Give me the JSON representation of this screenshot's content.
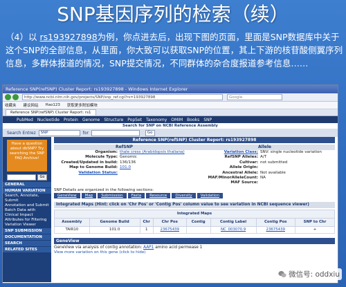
{
  "slide": {
    "title": "SNP基因序列的检索（续）",
    "paragraph_prefix": "（4）以 ",
    "paragraph_link": "rs193927898",
    "paragraph_rest": "为例，你点进去后，出现下图的页面，里面是SNP数据库中关于这个SNP的全部信息，从里面，你大致可以获取SNP的位置，其上下游的核苷酸侧翼序列信息，多群体报道的情况，SNP提交情况，不同群体的杂合度报道参考信息……"
  },
  "browser": {
    "window_title": "Reference SNP(refSNP) Cluster Report: rs193927898 - Windows Internet Explorer",
    "address": "http://www.ncbi.nlm.nih.gov/projects/SNP/snp_ref.cgi?rs=193927898",
    "search_placeholder": "Google",
    "favorites": [
      "收藏夹",
      "建议网站",
      "Hao123",
      "获取更多附加模块"
    ],
    "tab_label": "Reference SNP(refSNP) Cluster Report: rs1"
  },
  "ncbi": {
    "nav": [
      "PubMed",
      "Nucleotide",
      "Protein",
      "Genome",
      "Structure",
      "PopSet",
      "Taxonomy",
      "OMIM",
      "Books",
      "SNP"
    ],
    "search_ref": "Search for SNP on NCBI Reference Assembly",
    "search_label": "Search Entrez",
    "search_db": "SNP",
    "for_label": "for",
    "go_label": "Go",
    "promo": "Have a question about dbSNP? Try searching the SNP FAQ Archive!",
    "leftnav": {
      "sections": [
        "GENERAL",
        "HUMAN VARIATION"
      ],
      "items": [
        "Search, Annotate, Submit",
        "Annotation and Submit Batch Data with Clinical Impact",
        "Attributes for Filtering",
        "Variation Viewer"
      ],
      "more_sections": [
        "SNP SUBMISSION",
        "DOCUMENTATION",
        "SEARCH",
        "RELATED SITES"
      ]
    }
  },
  "report": {
    "header": "Reference SNP(refSNP) Cluster Report: rs193927898",
    "refsnp_label": "RefSNP",
    "allele_label": "Allele",
    "left": [
      {
        "k": "Organism:",
        "v": "thale cress (Arabidopsis thaliana)"
      },
      {
        "k": "Molecule Type:",
        "v": "Genomic"
      },
      {
        "k": "Created/Updated in build:",
        "v": "136/136"
      },
      {
        "k": "Map to Genome Build:",
        "v": "101.0"
      },
      {
        "k": "Validation Status:",
        "v": ""
      }
    ],
    "right": [
      {
        "k": "Variation Class:",
        "v": "SNV: single nucleotide variation"
      },
      {
        "k": "RefSNP Alleles:",
        "v": "A/T"
      },
      {
        "k": "Cultivar:",
        "v": "not submitted"
      },
      {
        "k": "Allele Origin:",
        "v": ""
      },
      {
        "k": "Ancestral Allele:",
        "v": "Not available"
      },
      {
        "k": "MAF/MinorAlleleCount:",
        "v": "NA"
      },
      {
        "k": "MAF Source:",
        "v": ""
      }
    ],
    "sections_note": "SNP Details are organized in the following sections:",
    "sections": [
      "GeneView",
      "Map",
      "Submission",
      "Fasta",
      "Resource",
      "Diversity",
      "Validation"
    ],
    "integrated_maps_title": "Integrated Maps (Hint: click on 'Chr Pos' or 'Contig Pos' column value to see variation in NCBI sequence viewer)",
    "integrated_maps_label": "Integrated Maps",
    "table": {
      "headers": [
        "Assembly",
        "Genome Build",
        "Chr",
        "Chr Pos",
        "Contig",
        "Contig Label",
        "Contig Pos",
        "SNP to Chr"
      ],
      "rows": [
        [
          "TAIR10",
          "101.0",
          "1",
          "23675439",
          "",
          "NC_003070.9",
          "23675439",
          "+"
        ]
      ]
    },
    "geneview_title": "GeneView",
    "geneview_text": "GeneView via analysis of contig annotation:",
    "geneview_gene": "AAP1",
    "geneview_rest": "amino acid permease 1",
    "view_more": "View more variation on this gene (click to hide)"
  },
  "watermark": "微信号: oddxiu"
}
